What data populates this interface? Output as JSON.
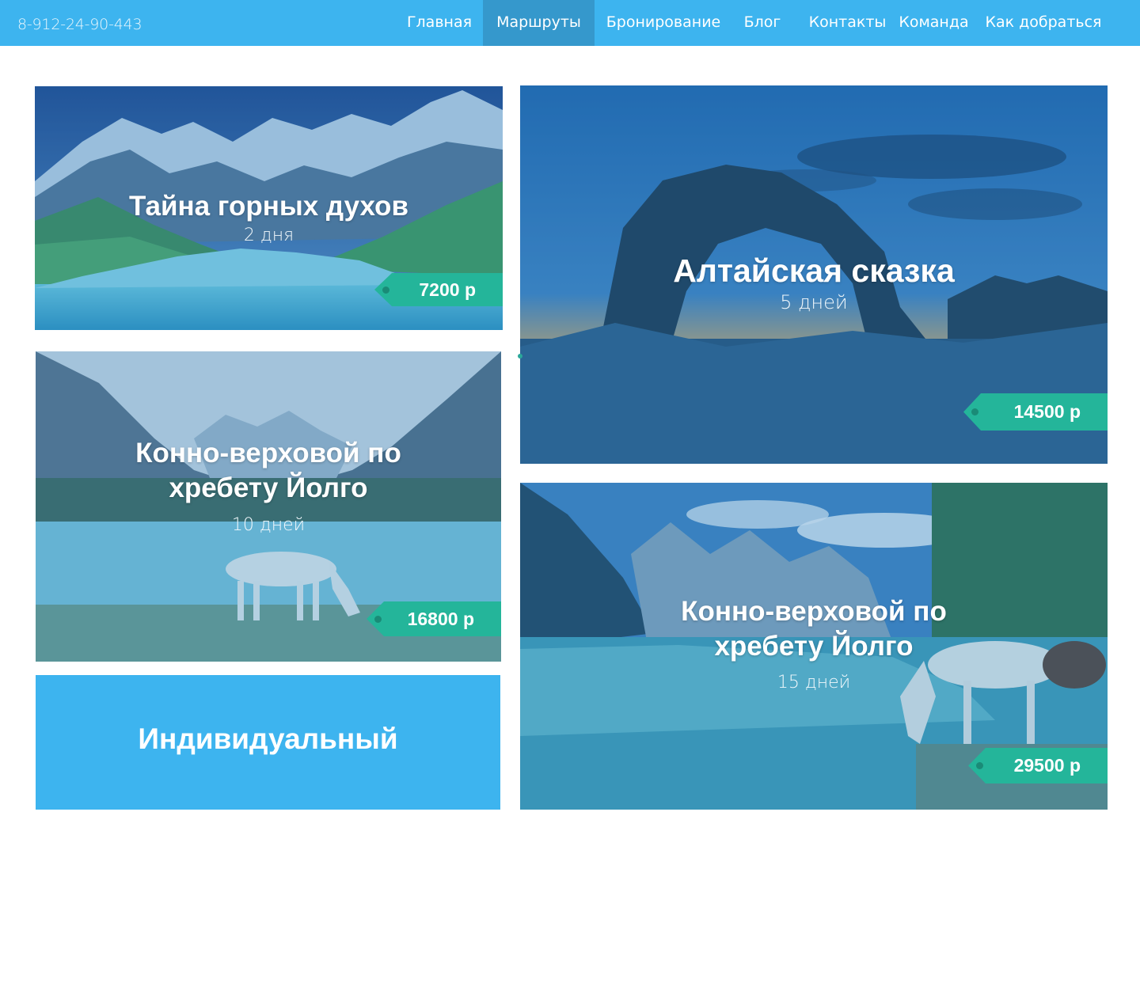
{
  "header": {
    "phone": "8-912-24-90-443",
    "nav": [
      {
        "label": "Главная"
      },
      {
        "label": "Маршруты",
        "active": true
      },
      {
        "label": "Бронирование"
      },
      {
        "label": "Блог"
      },
      {
        "label": "Контакты"
      },
      {
        "label": "Команда"
      },
      {
        "label": "Как добраться"
      }
    ]
  },
  "tours": [
    {
      "title": "Тайна горных духов",
      "duration": "2 дня",
      "price": "7200 р"
    },
    {
      "title": "Алтайская сказка",
      "duration": "5 дней",
      "price": "14500 р"
    },
    {
      "title_line1": "Конно-верховой по",
      "title_line2": "хребету Йолго",
      "duration": "10 дней",
      "price": "16800 р"
    },
    {
      "title_line1": "Конно-верховой по",
      "title_line2": "хребету Йолго",
      "duration": "15 дней",
      "price": "29500 р"
    }
  ],
  "individual": {
    "label": "Индивидуальный"
  },
  "colors": {
    "accent": "#3db4ef",
    "nav_active": "#3598cc",
    "price_tag": "#24b59a"
  }
}
